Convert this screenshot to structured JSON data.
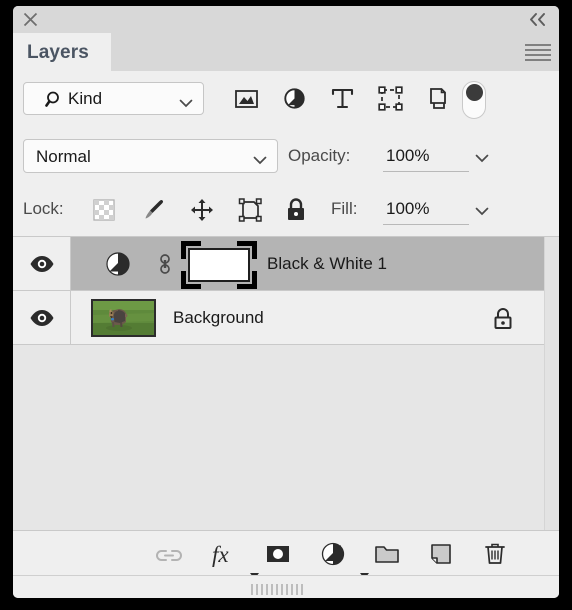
{
  "window": {
    "close_icon": "close-icon",
    "collapse_icon": "collapse-chevrons-icon",
    "menu_icon": "panel-menu-icon"
  },
  "tabs": [
    {
      "label": "Layers",
      "active": true
    }
  ],
  "filter_bar": {
    "kind_label": "Kind",
    "search_icon": "search-icon",
    "chevron_icon": "chevron-down-icon",
    "type_filters": [
      {
        "name": "filter-pixel-layers-icon",
        "title": "Filter for pixel layers"
      },
      {
        "name": "filter-adjustment-layers-icon",
        "title": "Filter for adjustment layers"
      },
      {
        "name": "filter-type-layers-icon",
        "title": "Filter for type layers"
      },
      {
        "name": "filter-shape-layers-icon",
        "title": "Filter for shape layers"
      },
      {
        "name": "filter-smart-object-icon",
        "title": "Filter for smart objects"
      }
    ],
    "toggle_name": "filter-enable-toggle"
  },
  "blend_row": {
    "mode": "Normal",
    "opacity_label": "Opacity:",
    "opacity_value": "100%"
  },
  "lock_row": {
    "lock_label": "Lock:",
    "lock_icons": [
      {
        "name": "lock-transparent-pixels-icon"
      },
      {
        "name": "lock-image-pixels-icon"
      },
      {
        "name": "lock-position-icon"
      },
      {
        "name": "lock-artboard-nesting-icon"
      },
      {
        "name": "lock-all-icon"
      }
    ],
    "fill_label": "Fill:",
    "fill_value": "100%"
  },
  "layers": [
    {
      "name": "Black & White 1",
      "selected": true,
      "visible": true,
      "kind": "adjustment",
      "linked": true,
      "mask_selected": true
    },
    {
      "name": "Background",
      "selected": false,
      "visible": true,
      "kind": "image",
      "locked": true
    }
  ],
  "toolbar": {
    "buttons": [
      {
        "name": "link-layers-button",
        "label": "Link layers",
        "disabled": true
      },
      {
        "name": "layer-styles-button",
        "label": "fx",
        "caret": true
      },
      {
        "name": "add-layer-mask-button",
        "label": "Add layer mask",
        "caret": false
      },
      {
        "name": "new-adjustment-layer-button",
        "label": "New adjustment layer",
        "caret": true
      },
      {
        "name": "new-group-button",
        "label": "New group",
        "caret": false
      },
      {
        "name": "new-layer-button",
        "label": "New layer",
        "caret": false
      },
      {
        "name": "delete-layer-button",
        "label": "Delete layer",
        "caret": false
      }
    ]
  },
  "colors": {
    "panel_bg": "#efefef",
    "titlebar": "#d8d8d8",
    "list_bg": "#e6e6e6",
    "selected_row": "#b4b4b4",
    "tab_text": "#4b5563",
    "label_text": "#4a4a4a",
    "value_text": "#1a1a1a"
  }
}
